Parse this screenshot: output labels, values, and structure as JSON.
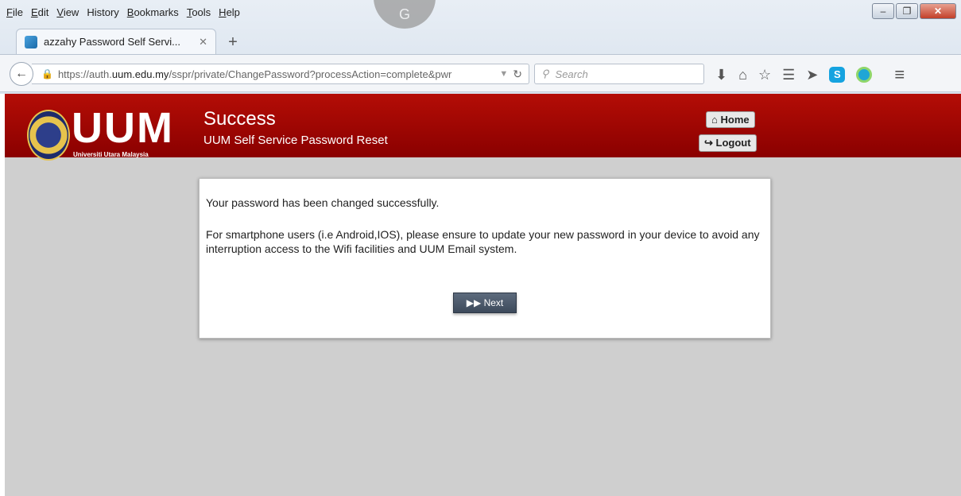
{
  "menu": {
    "items": [
      {
        "key": "F",
        "rest": "ile"
      },
      {
        "key": "E",
        "rest": "dit"
      },
      {
        "key": "V",
        "rest": "iew"
      },
      {
        "key": "",
        "rest": "History"
      },
      {
        "key": "B",
        "rest": "ookmarks"
      },
      {
        "key": "T",
        "rest": "ools"
      },
      {
        "key": "H",
        "rest": "elp"
      }
    ]
  },
  "browser": {
    "g_letter": "G",
    "tab_title": "azzahy Password Self Servi...",
    "tab_close": "✕",
    "new_tab": "+",
    "url_host": "https://auth.",
    "url_domain": "uum.edu.my",
    "url_path": "/sspr/private/ChangePassword?processAction=complete&pwr",
    "search_placeholder": "Search"
  },
  "header": {
    "logo_text": "UUM",
    "logo_sub": "Universiti Utara Malaysia",
    "title": "Success",
    "subtitle": "UUM Self Service Password Reset",
    "home_label": "Home",
    "logout_label": "Logout"
  },
  "card": {
    "message1": "Your password has been changed successfully.",
    "message2": "For smartphone users (i.e Android,IOS), please ensure to update your new password in your device to avoid any interruption access to the Wifi facilities and UUM Email system.",
    "next_label": "Next"
  }
}
